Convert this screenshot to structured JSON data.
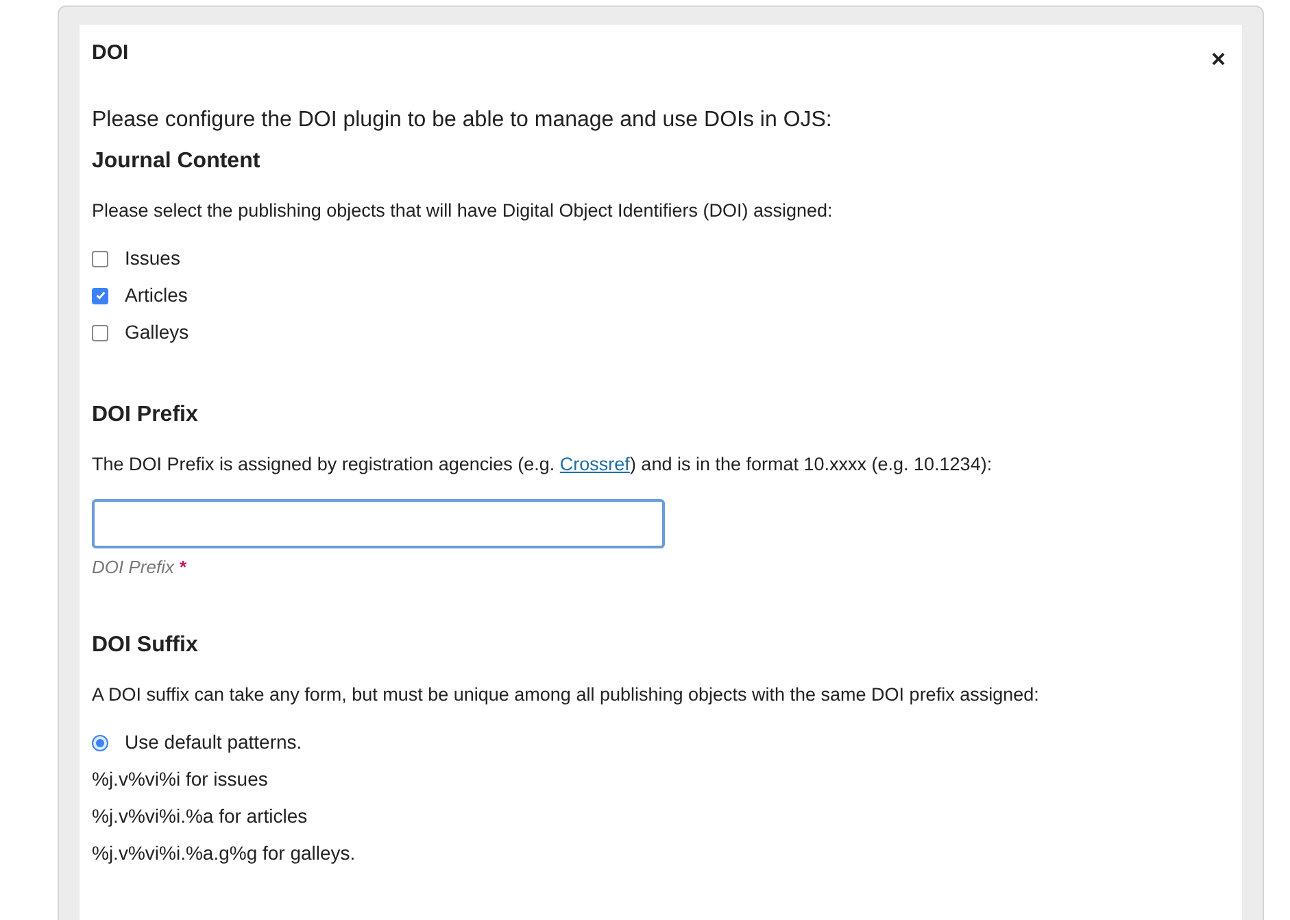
{
  "dialog": {
    "title": "DOI",
    "close": "×"
  },
  "intro": "Please configure the DOI plugin to be able to manage and use DOIs in OJS:",
  "journal_content": {
    "heading": "Journal Content",
    "description": "Please select the publishing objects that will have Digital Object Identifiers (DOI) assigned:",
    "options": [
      {
        "label": "Issues",
        "checked": false
      },
      {
        "label": "Articles",
        "checked": true
      },
      {
        "label": "Galleys",
        "checked": false
      }
    ]
  },
  "doi_prefix": {
    "heading": "DOI Prefix",
    "description_before": "The DOI Prefix is assigned by registration agencies (e.g. ",
    "link": "Crossref",
    "description_after": ") and is in the format 10.xxxx (e.g. 10.1234):",
    "field_label": "DOI Prefix",
    "required_mark": "*"
  },
  "doi_suffix": {
    "heading": "DOI Suffix",
    "description": "A DOI suffix can take any form, but must be unique among all publishing objects with the same DOI prefix assigned:",
    "options": [
      {
        "label": "Use default patterns.",
        "selected": true
      }
    ],
    "patterns": [
      "%j.v%vi%i for issues",
      "%j.v%vi%i.%a for articles",
      "%j.v%vi%i.%a.g%g for galleys."
    ]
  }
}
